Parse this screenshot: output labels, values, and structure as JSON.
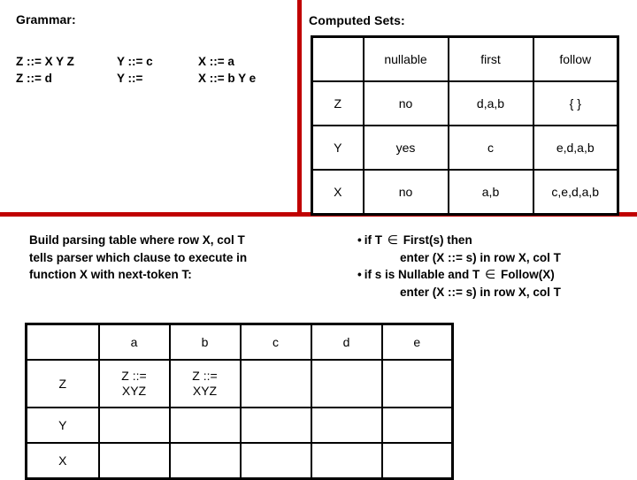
{
  "slide": {
    "accent_color": "#c00000",
    "background_color": "#ffffff",
    "text_color": "#000000"
  },
  "grammar": {
    "heading": "Grammar:",
    "columns": [
      [
        "Z ::= X Y Z",
        "Z ::= d"
      ],
      [
        "Y ::= c",
        "Y ::="
      ],
      [
        "X ::= a",
        "X ::= b Y e"
      ]
    ]
  },
  "computed_sets": {
    "heading": "Computed Sets:",
    "headers": [
      "",
      "nullable",
      "first",
      "follow"
    ],
    "rows": [
      {
        "symbol": "Z",
        "nullable": "no",
        "first": "d,a,b",
        "follow": "{ }"
      },
      {
        "symbol": "Y",
        "nullable": "yes",
        "first": "c",
        "follow": "e,d,a,b"
      },
      {
        "symbol": "X",
        "nullable": "no",
        "first": "a,b",
        "follow": "c,e,d,a,b"
      }
    ]
  },
  "instructions": {
    "lines": [
      "Build parsing table where row X, col T",
      "tells parser which clause to execute in",
      "function X with next-token T:"
    ]
  },
  "rules": {
    "bullet": "•",
    "element_of": "∈",
    "items": [
      {
        "main_before": "if T ",
        "main_after": " First(s) then",
        "continuation": "enter (X ::= s) in row X, col T"
      },
      {
        "main_before": "if s is Nullable and T ",
        "main_after": " Follow(X)",
        "continuation": "enter (X ::= s) in row X, col T"
      }
    ]
  },
  "parsing_table": {
    "headers": [
      "",
      "a",
      "b",
      "c",
      "d",
      "e"
    ],
    "rows": [
      {
        "symbol": "Z",
        "cells": [
          {
            "line1": "Z ::=",
            "line2": "XYZ"
          },
          {
            "line1": "Z ::=",
            "line2": "XYZ"
          },
          {
            "line1": "",
            "line2": ""
          },
          {
            "line1": "",
            "line2": ""
          },
          {
            "line1": "",
            "line2": ""
          }
        ]
      },
      {
        "symbol": "Y",
        "cells": [
          {
            "line1": "",
            "line2": ""
          },
          {
            "line1": "",
            "line2": ""
          },
          {
            "line1": "",
            "line2": ""
          },
          {
            "line1": "",
            "line2": ""
          },
          {
            "line1": "",
            "line2": ""
          }
        ]
      },
      {
        "symbol": "X",
        "cells": [
          {
            "line1": "",
            "line2": ""
          },
          {
            "line1": "",
            "line2": ""
          },
          {
            "line1": "",
            "line2": ""
          },
          {
            "line1": "",
            "line2": ""
          },
          {
            "line1": "",
            "line2": ""
          }
        ]
      }
    ]
  }
}
